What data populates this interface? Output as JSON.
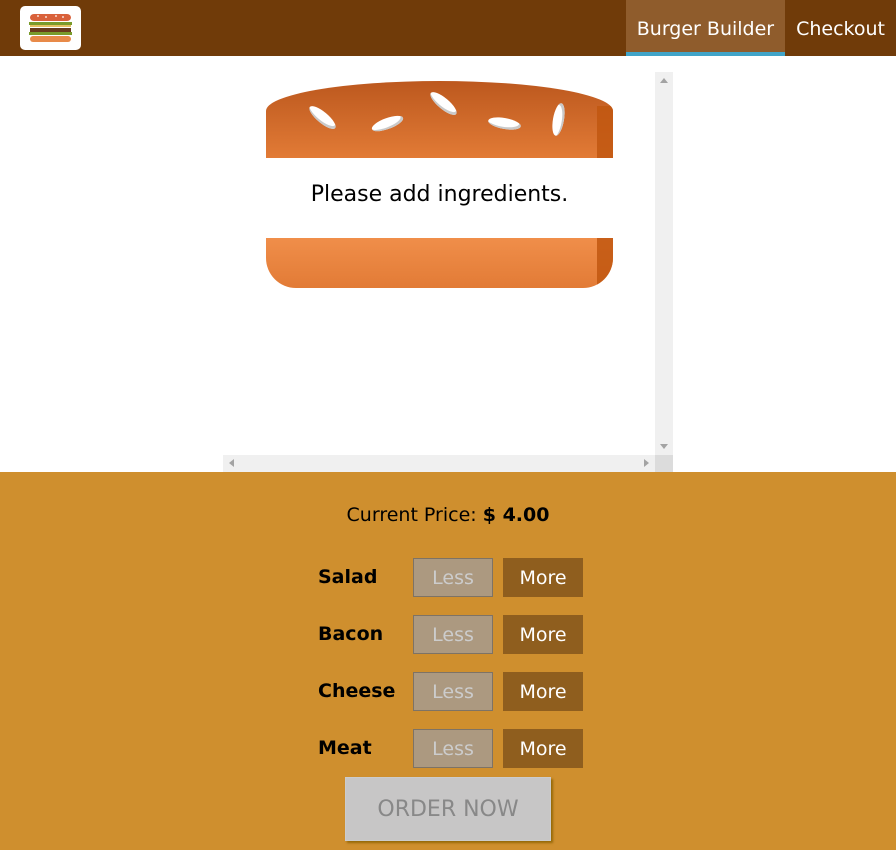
{
  "toolbar": {
    "logo_icon": "burger-logo-icon",
    "nav": [
      {
        "label": "Burger Builder",
        "active": true
      },
      {
        "label": "Checkout",
        "active": false
      }
    ],
    "background": "#703b09",
    "active_indicator": "#40a4c8"
  },
  "burger": {
    "empty_message": "Please add ingredients."
  },
  "controls": {
    "price_label": "Current Price:",
    "price_value": "$ 4.00",
    "less_label": "Less",
    "more_label": "More",
    "ingredients": [
      {
        "label": "Salad"
      },
      {
        "label": "Bacon"
      },
      {
        "label": "Cheese"
      },
      {
        "label": "Meat"
      }
    ],
    "order_label": "ORDER NOW",
    "background": "#cf8f2e"
  }
}
